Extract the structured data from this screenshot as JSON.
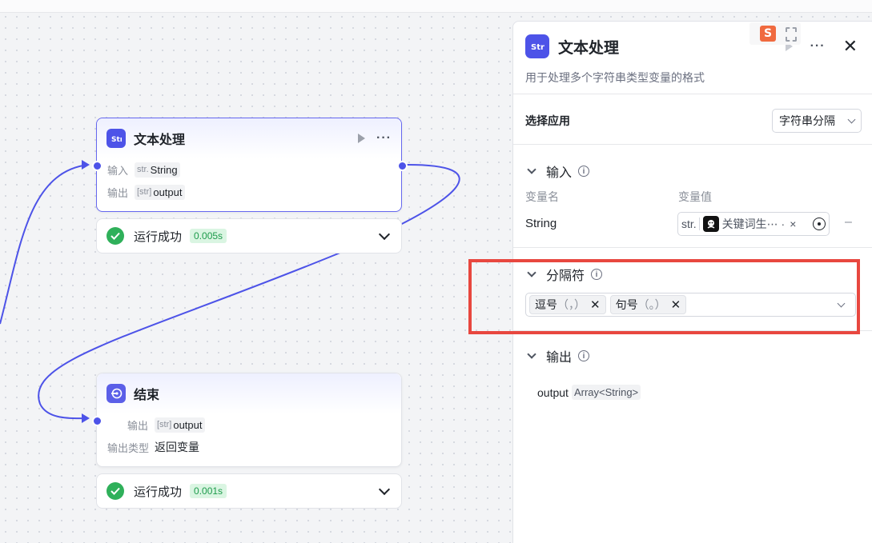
{
  "canvas": {
    "text_node": {
      "title": "文本处理",
      "input_label": "输入",
      "input_type": "str.",
      "input_value": "String",
      "output_label": "输出",
      "output_type": "[str]",
      "output_value": "output",
      "status": "运行成功",
      "time": "0.005s"
    },
    "end_node": {
      "title": "结束",
      "output_label": "输出",
      "output_type": "[str]",
      "output_value": "output",
      "output_kind_label": "输出类型",
      "output_kind_value": "返回变量",
      "status": "运行成功",
      "time": "0.001s"
    }
  },
  "panel": {
    "title": "文本处理",
    "description": "用于处理多个字符串类型变量的格式",
    "app_label": "选择应用",
    "app_value": "字符串分隔",
    "input": {
      "heading": "输入",
      "col_name": "变量名",
      "col_value": "变量值",
      "var_name": "String",
      "value_type": "str.",
      "value_text": "关键词生⋯ ·",
      "remove": "×",
      "minus": "–"
    },
    "separator": {
      "heading": "分隔符",
      "chips": [
        {
          "label": "逗号",
          "hint": "（，）"
        },
        {
          "label": "句号",
          "hint": "（。）"
        }
      ]
    },
    "output": {
      "heading": "输出",
      "name": "output",
      "type": "Array<String>"
    }
  },
  "colors": {
    "accent": "#4d53e8",
    "success": "#2fb05a",
    "highlight": "#e8473f"
  }
}
